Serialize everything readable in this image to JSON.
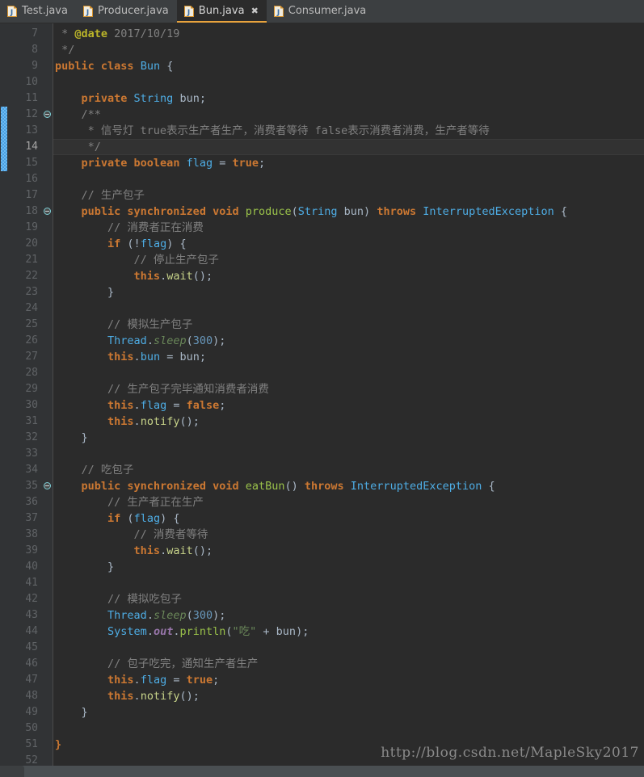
{
  "window": {
    "title": "Bun.java",
    "theme": "darcula",
    "colors": {
      "editor_bg": "#2b2b2b",
      "gutter_bg": "#313335",
      "tabbar_bg": "#3c3f41",
      "active_tab_accent": "#e8a33d",
      "current_line_bg": "#323232",
      "change_marker": "#4b9ee0",
      "keyword": "#cc7832",
      "class": "#4eade5",
      "method": "#9ac24a",
      "static_field": "#9876aa",
      "number": "#6897bb",
      "string": "#6a8759",
      "comment": "#808080",
      "javadoc_tag": "#bbb529",
      "default_text": "#a9b7c6"
    }
  },
  "tabs": [
    {
      "label": "Test.java",
      "icon": "java-file-icon",
      "active": false,
      "closable": false
    },
    {
      "label": "Producer.java",
      "icon": "java-file-icon",
      "active": false,
      "closable": false
    },
    {
      "label": "Bun.java",
      "icon": "java-file-icon",
      "active": true,
      "closable": true,
      "close_icon": "✖"
    },
    {
      "label": "Consumer.java",
      "icon": "java-file-icon",
      "active": false,
      "closable": false
    }
  ],
  "editor": {
    "first_line_number": 7,
    "current_line": 14,
    "change_marker_lines": [
      12,
      13,
      14,
      15
    ],
    "fold_marker_lines": [
      12,
      18,
      35
    ],
    "watermark": "http://blog.csdn.net/MapleSky2017",
    "lines": [
      {
        "n": 7,
        "tokens": [
          {
            "t": " * ",
            "c": "cmt"
          },
          {
            "t": "@date",
            "c": "tag"
          },
          {
            "t": " 2017/10/19",
            "c": "cmt"
          }
        ]
      },
      {
        "n": 8,
        "tokens": [
          {
            "t": " */",
            "c": "cmt"
          }
        ]
      },
      {
        "n": 9,
        "tokens": [
          {
            "t": "public ",
            "c": "kw"
          },
          {
            "t": "class ",
            "c": "kw"
          },
          {
            "t": "Bun",
            "c": "cls"
          },
          {
            "t": " {",
            "c": "pln"
          }
        ]
      },
      {
        "n": 10,
        "tokens": []
      },
      {
        "n": 11,
        "tokens": [
          {
            "t": "    ",
            "c": "pln"
          },
          {
            "t": "private ",
            "c": "kw"
          },
          {
            "t": "String",
            "c": "cls"
          },
          {
            "t": " bun;",
            "c": "pln"
          }
        ]
      },
      {
        "n": 12,
        "tokens": [
          {
            "t": "    /**",
            "c": "cmt"
          }
        ]
      },
      {
        "n": 13,
        "tokens": [
          {
            "t": "     * 信号灯 true表示生产者生产，消费者等待 false表示消费者消费，生产者等待",
            "c": "cmt"
          }
        ]
      },
      {
        "n": 14,
        "tokens": [
          {
            "t": "     */",
            "c": "cmt"
          }
        ]
      },
      {
        "n": 15,
        "tokens": [
          {
            "t": "    ",
            "c": "pln"
          },
          {
            "t": "private ",
            "c": "kw"
          },
          {
            "t": "boolean ",
            "c": "kw"
          },
          {
            "t": "flag",
            "c": "fld"
          },
          {
            "t": " = ",
            "c": "pln"
          },
          {
            "t": "true",
            "c": "kw"
          },
          {
            "t": ";",
            "c": "pln"
          }
        ]
      },
      {
        "n": 16,
        "tokens": []
      },
      {
        "n": 17,
        "tokens": [
          {
            "t": "    // 生产包子",
            "c": "cmt"
          }
        ]
      },
      {
        "n": 18,
        "tokens": [
          {
            "t": "    ",
            "c": "pln"
          },
          {
            "t": "public synchronized void ",
            "c": "kw"
          },
          {
            "t": "produce",
            "c": "mth"
          },
          {
            "t": "(",
            "c": "pln"
          },
          {
            "t": "String",
            "c": "cls"
          },
          {
            "t": " bun) ",
            "c": "pln"
          },
          {
            "t": "throws ",
            "c": "kw"
          },
          {
            "t": "InterruptedException",
            "c": "cls"
          },
          {
            "t": " {",
            "c": "pln"
          }
        ]
      },
      {
        "n": 19,
        "tokens": [
          {
            "t": "        // 消费者正在消费",
            "c": "cmt"
          }
        ]
      },
      {
        "n": 20,
        "tokens": [
          {
            "t": "        ",
            "c": "pln"
          },
          {
            "t": "if",
            "c": "kw"
          },
          {
            "t": " (!",
            "c": "pln"
          },
          {
            "t": "flag",
            "c": "fld"
          },
          {
            "t": ") {",
            "c": "pln"
          }
        ]
      },
      {
        "n": 21,
        "tokens": [
          {
            "t": "            // 停止生产包子",
            "c": "cmt"
          }
        ]
      },
      {
        "n": 22,
        "tokens": [
          {
            "t": "            ",
            "c": "pln"
          },
          {
            "t": "this",
            "c": "kw"
          },
          {
            "t": ".",
            "c": "pln"
          },
          {
            "t": "wait",
            "c": "mcall"
          },
          {
            "t": "();",
            "c": "pln"
          }
        ]
      },
      {
        "n": 23,
        "tokens": [
          {
            "t": "        }",
            "c": "pln"
          }
        ]
      },
      {
        "n": 24,
        "tokens": []
      },
      {
        "n": 25,
        "tokens": [
          {
            "t": "        // 模拟生产包子",
            "c": "cmt"
          }
        ]
      },
      {
        "n": 26,
        "tokens": [
          {
            "t": "        ",
            "c": "pln"
          },
          {
            "t": "Thread",
            "c": "cls"
          },
          {
            "t": ".",
            "c": "pln"
          },
          {
            "t": "sleep",
            "c": "smth"
          },
          {
            "t": "(",
            "c": "pln"
          },
          {
            "t": "300",
            "c": "num"
          },
          {
            "t": ");",
            "c": "pln"
          }
        ]
      },
      {
        "n": 27,
        "tokens": [
          {
            "t": "        ",
            "c": "pln"
          },
          {
            "t": "this",
            "c": "kw"
          },
          {
            "t": ".",
            "c": "pln"
          },
          {
            "t": "bun",
            "c": "fld"
          },
          {
            "t": " = bun;",
            "c": "pln"
          }
        ]
      },
      {
        "n": 28,
        "tokens": []
      },
      {
        "n": 29,
        "tokens": [
          {
            "t": "        // 生产包子完毕通知消费者消费",
            "c": "cmt"
          }
        ]
      },
      {
        "n": 30,
        "tokens": [
          {
            "t": "        ",
            "c": "pln"
          },
          {
            "t": "this",
            "c": "kw"
          },
          {
            "t": ".",
            "c": "pln"
          },
          {
            "t": "flag",
            "c": "fld"
          },
          {
            "t": " = ",
            "c": "pln"
          },
          {
            "t": "false",
            "c": "kw"
          },
          {
            "t": ";",
            "c": "pln"
          }
        ]
      },
      {
        "n": 31,
        "tokens": [
          {
            "t": "        ",
            "c": "pln"
          },
          {
            "t": "this",
            "c": "kw"
          },
          {
            "t": ".",
            "c": "pln"
          },
          {
            "t": "notify",
            "c": "mcall"
          },
          {
            "t": "();",
            "c": "pln"
          }
        ]
      },
      {
        "n": 32,
        "tokens": [
          {
            "t": "    }",
            "c": "pln"
          }
        ]
      },
      {
        "n": 33,
        "tokens": []
      },
      {
        "n": 34,
        "tokens": [
          {
            "t": "    // 吃包子",
            "c": "cmt"
          }
        ]
      },
      {
        "n": 35,
        "tokens": [
          {
            "t": "    ",
            "c": "pln"
          },
          {
            "t": "public synchronized void ",
            "c": "kw"
          },
          {
            "t": "eatBun",
            "c": "mth"
          },
          {
            "t": "() ",
            "c": "pln"
          },
          {
            "t": "throws ",
            "c": "kw"
          },
          {
            "t": "InterruptedException",
            "c": "cls"
          },
          {
            "t": " {",
            "c": "pln"
          }
        ]
      },
      {
        "n": 36,
        "tokens": [
          {
            "t": "        // 生产者正在生产",
            "c": "cmt"
          }
        ]
      },
      {
        "n": 37,
        "tokens": [
          {
            "t": "        ",
            "c": "pln"
          },
          {
            "t": "if",
            "c": "kw"
          },
          {
            "t": " (",
            "c": "pln"
          },
          {
            "t": "flag",
            "c": "fld"
          },
          {
            "t": ") {",
            "c": "pln"
          }
        ]
      },
      {
        "n": 38,
        "tokens": [
          {
            "t": "            // 消费者等待",
            "c": "cmt"
          }
        ]
      },
      {
        "n": 39,
        "tokens": [
          {
            "t": "            ",
            "c": "pln"
          },
          {
            "t": "this",
            "c": "kw"
          },
          {
            "t": ".",
            "c": "pln"
          },
          {
            "t": "wait",
            "c": "mcall"
          },
          {
            "t": "();",
            "c": "pln"
          }
        ]
      },
      {
        "n": 40,
        "tokens": [
          {
            "t": "        }",
            "c": "pln"
          }
        ]
      },
      {
        "n": 41,
        "tokens": []
      },
      {
        "n": 42,
        "tokens": [
          {
            "t": "        // 模拟吃包子",
            "c": "cmt"
          }
        ]
      },
      {
        "n": 43,
        "tokens": [
          {
            "t": "        ",
            "c": "pln"
          },
          {
            "t": "Thread",
            "c": "cls"
          },
          {
            "t": ".",
            "c": "pln"
          },
          {
            "t": "sleep",
            "c": "smth"
          },
          {
            "t": "(",
            "c": "pln"
          },
          {
            "t": "300",
            "c": "num"
          },
          {
            "t": ");",
            "c": "pln"
          }
        ]
      },
      {
        "n": 44,
        "tokens": [
          {
            "t": "        ",
            "c": "pln"
          },
          {
            "t": "System",
            "c": "cls"
          },
          {
            "t": ".",
            "c": "pln"
          },
          {
            "t": "out",
            "c": "stat"
          },
          {
            "t": ".",
            "c": "pln"
          },
          {
            "t": "println",
            "c": "mth"
          },
          {
            "t": "(",
            "c": "pln"
          },
          {
            "t": "\"吃\"",
            "c": "str"
          },
          {
            "t": " + bun);",
            "c": "pln"
          }
        ]
      },
      {
        "n": 45,
        "tokens": []
      },
      {
        "n": 46,
        "tokens": [
          {
            "t": "        // 包子吃完，通知生产者生产",
            "c": "cmt"
          }
        ]
      },
      {
        "n": 47,
        "tokens": [
          {
            "t": "        ",
            "c": "pln"
          },
          {
            "t": "this",
            "c": "kw"
          },
          {
            "t": ".",
            "c": "pln"
          },
          {
            "t": "flag",
            "c": "fld"
          },
          {
            "t": " = ",
            "c": "pln"
          },
          {
            "t": "true",
            "c": "kw"
          },
          {
            "t": ";",
            "c": "pln"
          }
        ]
      },
      {
        "n": 48,
        "tokens": [
          {
            "t": "        ",
            "c": "pln"
          },
          {
            "t": "this",
            "c": "kw"
          },
          {
            "t": ".",
            "c": "pln"
          },
          {
            "t": "notify",
            "c": "mcall"
          },
          {
            "t": "();",
            "c": "pln"
          }
        ]
      },
      {
        "n": 49,
        "tokens": [
          {
            "t": "    }",
            "c": "pln"
          }
        ]
      },
      {
        "n": 50,
        "tokens": []
      },
      {
        "n": 51,
        "tokens": [
          {
            "t": "}",
            "c": "kw"
          }
        ]
      },
      {
        "n": 52,
        "tokens": []
      }
    ]
  }
}
